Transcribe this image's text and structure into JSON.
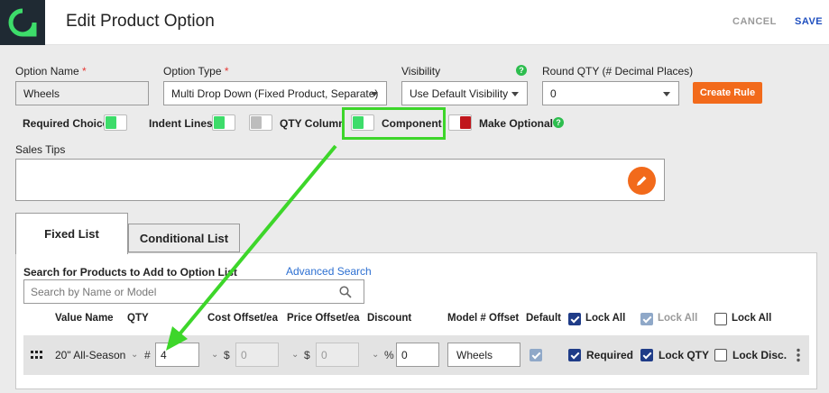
{
  "header": {
    "title": "Edit Product Option",
    "cancel": "CANCEL",
    "save": "SAVE"
  },
  "form": {
    "option_name_label": "Option Name",
    "option_name_value": "Wheels",
    "option_type_label": "Option Type",
    "option_type_value": "Multi Drop Down (Fixed Product, Separate)",
    "visibility_label": "Visibility",
    "visibility_value": "Use Default Visibility",
    "round_qty_label": "Round QTY (# Decimal Places)",
    "round_qty_value": "0",
    "create_rule": "Create Rule",
    "required_mark": "*",
    "help_glyph": "?"
  },
  "toggles": {
    "required_choice": "Required Choice",
    "indent_lines": "Indent Lines",
    "qty_column": "QTY Column",
    "component": "Component",
    "make_optional": "Make Optional"
  },
  "sales_tips_label": "Sales Tips",
  "tabs": {
    "fixed": "Fixed List",
    "conditional": "Conditional List"
  },
  "list": {
    "search_label": "Search for Products to Add to Option List",
    "advanced_search": "Advanced Search",
    "search_placeholder": "Search by Name or Model",
    "headers": {
      "value_name": "Value Name",
      "qty": "QTY",
      "cost_offset": "Cost Offset/ea",
      "price_offset": "Price Offset/ea",
      "discount": "Discount",
      "model_offset": "Model # Offset",
      "default": "Default",
      "lock_all_1": "Lock All",
      "lock_all_2": "Lock All",
      "lock_all_3": "Lock All"
    },
    "row": {
      "value_name": "20\" All-Season",
      "qty_symbol": "#",
      "qty": "4",
      "cost_symbol": "$",
      "cost": "0",
      "price_symbol": "$",
      "price": "0",
      "discount_symbol": "%",
      "discount": "0",
      "model": "Wheels",
      "required": "Required",
      "lock_qty": "Lock QTY",
      "lock_disc": "Lock Disc."
    }
  },
  "colors": {
    "accent": "#f26a1b",
    "brand": "#1f2a33",
    "highlight": "#3dd62a",
    "link": "#2c6fd1"
  }
}
